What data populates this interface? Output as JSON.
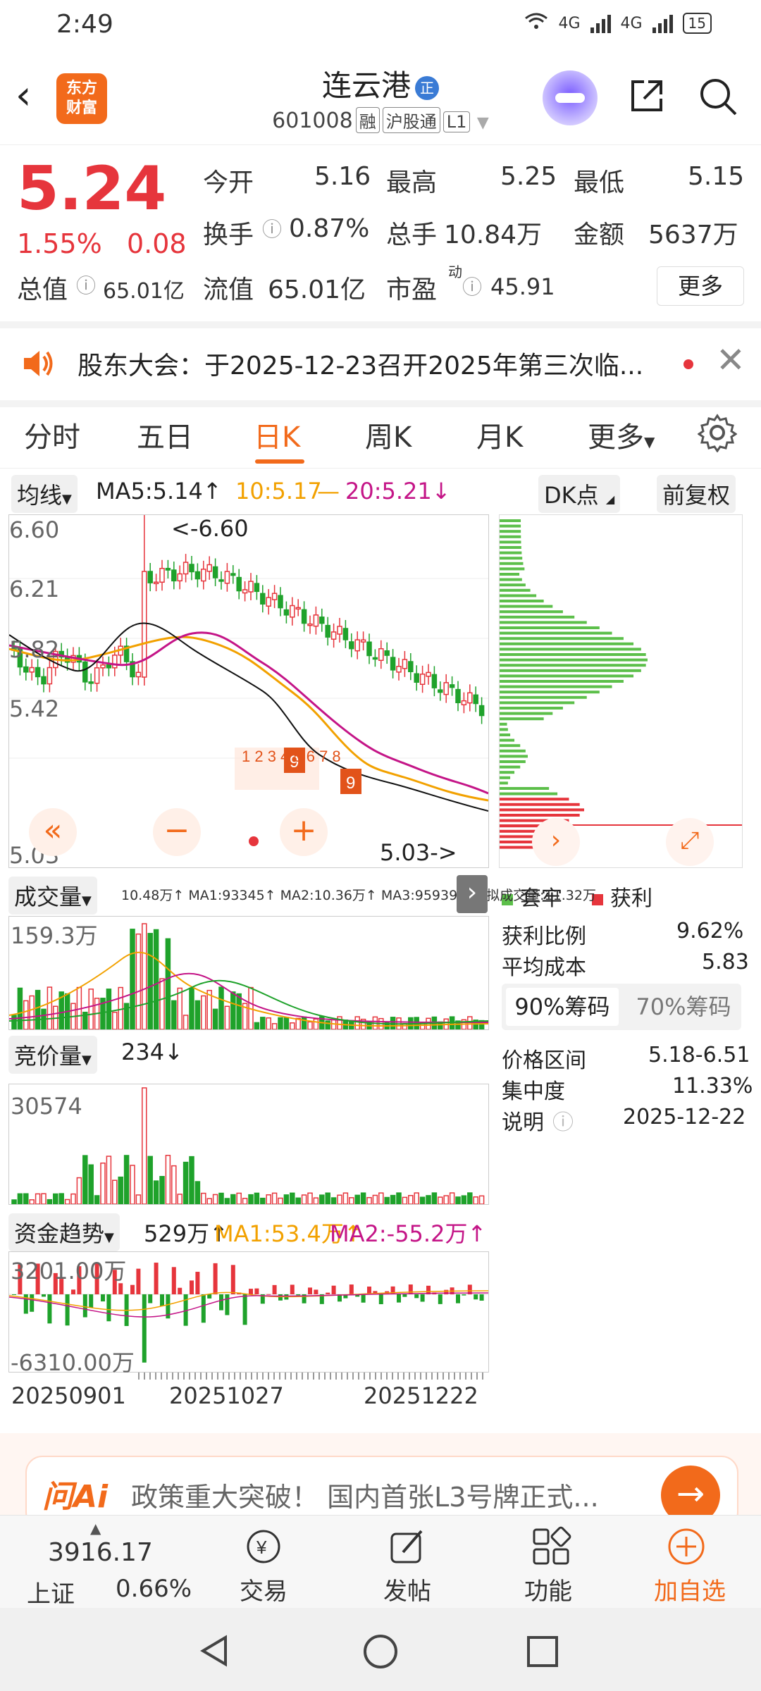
{
  "status": {
    "time": "2:49",
    "net1": "4G",
    "net2": "4G",
    "battery": "15"
  },
  "header": {
    "title": "连云港",
    "badge": "正",
    "code": "601008",
    "tags": [
      "融",
      "沪股通",
      "L1"
    ],
    "logo_line1": "东方",
    "logo_line2": "财富"
  },
  "quote": {
    "price": "5.24",
    "change_pct": "1.55%",
    "change": "0.08",
    "open_label": "今开",
    "open": "5.16",
    "high_label": "最高",
    "high": "5.25",
    "low_label": "最低",
    "low": "5.15",
    "turnover_label": "换手",
    "turnover": "0.87%",
    "volume_label": "总手",
    "volume": "10.84万",
    "amount_label": "金额",
    "amount": "5637万",
    "mktcap_label": "总值",
    "mktcap": "65.01亿",
    "float_label": "流值",
    "float": "65.01亿",
    "pe_label": "市盈",
    "pe_sup": "动",
    "pe": "45.91",
    "more": "更多"
  },
  "notice": {
    "text": "股东大会：于2025-12-23召开2025年第三次临..."
  },
  "tabs": [
    "分时",
    "五日",
    "日K",
    "周K",
    "月K",
    "更多"
  ],
  "chart": {
    "ma_btn": "均线",
    "ma5": "MA5:5.14↑",
    "ma10": "10:5.17",
    "ma20": "20:5.21↓",
    "dk_btn": "DK点",
    "fq_btn": "前复权",
    "axis": [
      "6.60",
      "6.21",
      "5.82",
      "5.42",
      "5.03"
    ],
    "max_note": "<-6.60",
    "min_note": "5.03->",
    "vol_btn": "成交量",
    "vol_line": "10.48万↑ MA1:93345↑ MA2:10.36万↑ MA3:95939↓ 虚拟成交量:11.32万",
    "vol_max": "159.3万",
    "bid_btn": "竞价量",
    "bid_val": "234↓",
    "bid_max": "30574",
    "fund_btn": "资金趋势",
    "fund_val": "529万↑",
    "fund_ma1": "MA1:53.4万↑",
    "fund_ma2": "MA2:-55.2万↑",
    "fund_max": "3201.00万",
    "fund_min": "-6310.00万",
    "dates": [
      "20250901",
      "20251027",
      "20251222"
    ]
  },
  "chips": {
    "legend_trap": "套牢",
    "legend_profit": "获利",
    "profit_ratio_label": "获利比例",
    "profit_ratio": "9.62%",
    "avg_cost_label": "平均成本",
    "avg_cost": "5.83",
    "seg_on": "90%筹码",
    "seg_off": "70%筹码",
    "range_label": "价格区间",
    "range": "5.18-6.51",
    "conc_label": "集中度",
    "conc": "11.33%",
    "note_label": "说明",
    "note": "2025-12-22"
  },
  "ai": {
    "logo": "问Ai",
    "text": "政策重大突破！ 国内首张L3号牌正式..."
  },
  "bottom": {
    "index_value": "3916.17",
    "index_name": "上证",
    "index_pct": "0.66%",
    "trade": "交易",
    "post": "发帖",
    "func": "功能",
    "watch": "加自选"
  },
  "colors": {
    "up": "#e6353c",
    "down": "#1fa22b",
    "accent": "#f26a1b"
  }
}
